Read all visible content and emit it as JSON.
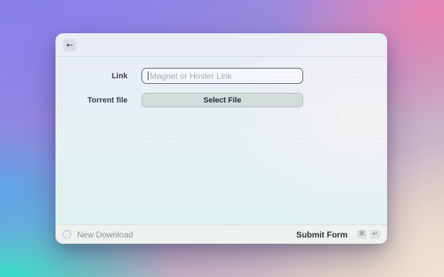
{
  "window": {
    "header": {
      "back_label": "←"
    },
    "form": {
      "fields": [
        {
          "label": "Link",
          "type": "input",
          "placeholder": "Magnet or Hoster Link",
          "value": ""
        },
        {
          "label": "Torrent file",
          "type": "button",
          "button_label": "Select File"
        }
      ]
    },
    "footer": {
      "title": "New Download",
      "submit_label": "Submit Form",
      "shortcuts": [
        "⌘",
        "↵"
      ]
    }
  },
  "colors": {
    "bg_top_left": "#8a80e9",
    "bg_top_right": "#e981b1",
    "bg_mid_left": "#56a6e8",
    "bg_bottom_left": "#34dec6",
    "bg_bottom_right": "#f1e1d0",
    "input_border": "#565c63",
    "button_bg": "#d4dddb",
    "footer_bg": "#f1f2ee"
  }
}
